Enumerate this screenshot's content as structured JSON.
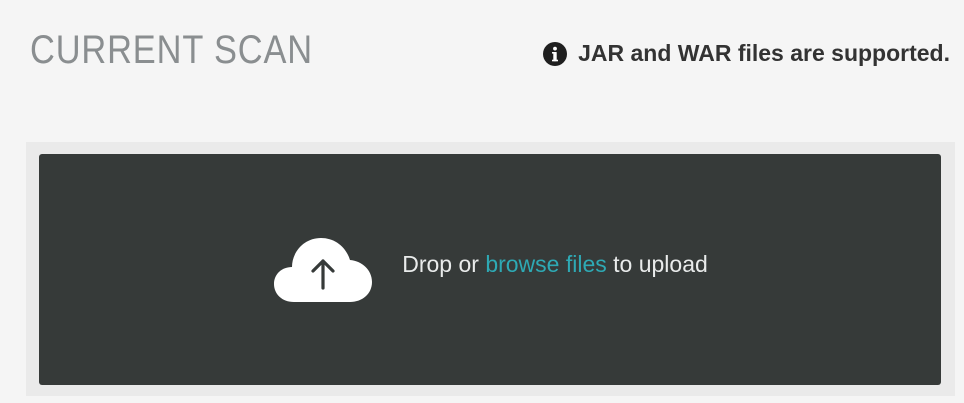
{
  "header": {
    "title": "CURRENT SCAN",
    "info_icon": "info-circle-icon",
    "info_text": "JAR and WAR files are supported."
  },
  "upload": {
    "icon": "cloud-upload-icon",
    "drop_prefix": "Drop or",
    "browse_label": "browse files",
    "drop_suffix": "to upload"
  },
  "colors": {
    "background": "#f5f5f5",
    "dropzone": "#363a39",
    "link": "#2ea9b4",
    "title": "#8a8e90"
  }
}
